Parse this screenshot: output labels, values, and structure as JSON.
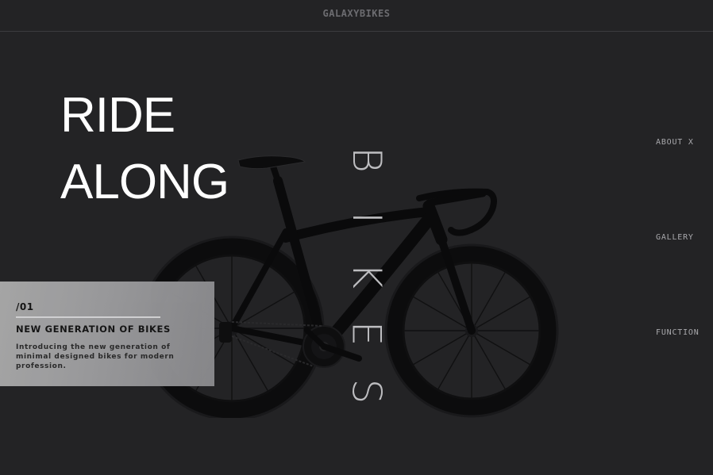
{
  "brand": {
    "logo": "GALAXYBIKES"
  },
  "hero": {
    "headline_line1": "RIDE",
    "headline_line2": "ALONG",
    "vertical_letters": [
      "B",
      "I",
      "K",
      "E",
      "S"
    ]
  },
  "nav": {
    "items": [
      {
        "label": "ABOUT X"
      },
      {
        "label": "GALLERY"
      },
      {
        "label": "FUNCTION"
      }
    ]
  },
  "feature_card": {
    "index": "/01",
    "title": "NEW GENERATION OF BIKES",
    "description": "Introducing the new generation of minimal designed bikes for modern profession."
  },
  "colors": {
    "background": "#232325",
    "headline": "#ffffff",
    "vertical_word": "#bdbdc0",
    "nav_text": "#a8a8ac",
    "card_bg": "#a3a3a5",
    "card_text": "#151515"
  },
  "icons": {
    "product_image": "road-bike-image"
  }
}
